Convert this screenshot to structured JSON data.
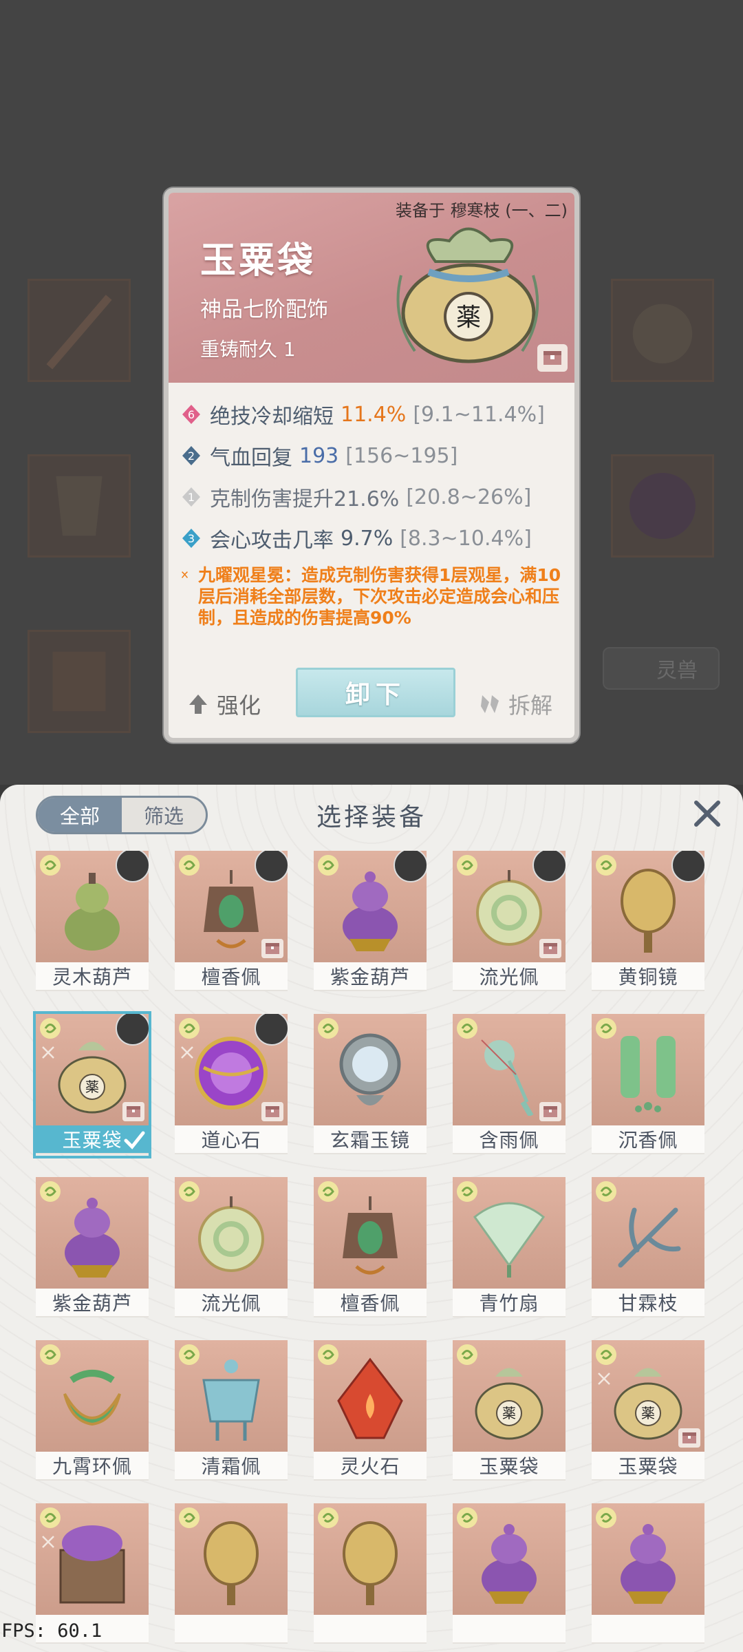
{
  "card": {
    "equipped_on": "装备于 穆寒枝 (一、二)",
    "name": "玉粟袋",
    "grade": "神品七阶配饰",
    "reforge": "重铸耐久 1",
    "stats": [
      {
        "badge": "6",
        "label": "绝技冷却缩短",
        "value": "11.4%",
        "range": "[9.1~11.4%]",
        "badge_color": "#e0608a",
        "value_color": "#e5761c"
      },
      {
        "badge": "2",
        "label": "气血回复",
        "value": "193",
        "range": "[156~195]",
        "badge_color": "#4a6d8c",
        "value_color": "#4a6da8"
      },
      {
        "badge": "1",
        "label": "克制伤害提升21.6%",
        "value": "",
        "range": "[20.8~26%]",
        "badge_color": "#c9c9c9",
        "value_color": "#6c7480"
      },
      {
        "badge": "3",
        "label": "会心攻击几率",
        "value": "9.7%",
        "range": "[8.3~10.4%]",
        "badge_color": "#3aa0c8",
        "value_color": "#4e5d6f"
      }
    ],
    "effect": "九曜观星冕：造成克制伤害获得1层观星，满10层后消耗全部层数，下次攻击必定造成会心和压制，且造成的伤害提高90%",
    "actions": {
      "enhance": "强化",
      "unequip": "卸下",
      "dismantle": "拆解"
    }
  },
  "background": {
    "pill_label": "灵兽"
  },
  "panel": {
    "tabs": [
      "全部",
      "筛选"
    ],
    "title": "选择装备",
    "items": [
      {
        "name": "灵木葫芦",
        "art": "gourd-green",
        "avatar": true,
        "chest": false
      },
      {
        "name": "檀香佩",
        "art": "pendant-jade",
        "avatar": true,
        "chest": true
      },
      {
        "name": "紫金葫芦",
        "art": "gourd-purple",
        "avatar": true,
        "chest": false
      },
      {
        "name": "流光佩",
        "art": "disc-jade",
        "avatar": true,
        "chest": true
      },
      {
        "name": "黄铜镜",
        "art": "mirror-brass",
        "avatar": true,
        "chest": false
      },
      {
        "name": "玉粟袋",
        "art": "bag",
        "avatar": true,
        "chest": true,
        "selected": true,
        "lock": true
      },
      {
        "name": "道心石",
        "art": "orb-purple",
        "avatar": true,
        "chest": true,
        "lock": true
      },
      {
        "name": "玄霜玉镜",
        "art": "mirror-frost",
        "avatar": false,
        "chest": false
      },
      {
        "name": "含雨佩",
        "art": "tassel-jade",
        "avatar": false,
        "chest": true
      },
      {
        "name": "沉香佩",
        "art": "jade-chain",
        "avatar": false,
        "chest": false
      },
      {
        "name": "紫金葫芦",
        "art": "gourd-purple",
        "avatar": false,
        "chest": false
      },
      {
        "name": "流光佩",
        "art": "disc-jade",
        "avatar": false,
        "chest": false
      },
      {
        "name": "檀香佩",
        "art": "pendant-jade",
        "avatar": false,
        "chest": false
      },
      {
        "name": "青竹扇",
        "art": "fan",
        "avatar": false,
        "chest": false
      },
      {
        "name": "甘霖枝",
        "art": "branch",
        "avatar": false,
        "chest": false
      },
      {
        "name": "九霄环佩",
        "art": "ring-jade",
        "avatar": false,
        "chest": false
      },
      {
        "name": "清霜佩",
        "art": "jade-blue",
        "avatar": false,
        "chest": false
      },
      {
        "name": "灵火石",
        "art": "fire-stone",
        "avatar": false,
        "chest": false
      },
      {
        "name": "玉粟袋",
        "art": "bag",
        "avatar": false,
        "chest": false
      },
      {
        "name": "玉粟袋",
        "art": "bag",
        "avatar": false,
        "chest": true,
        "lock": true
      },
      {
        "name": "",
        "art": "box-purple",
        "avatar": false,
        "chest": false,
        "lock": true
      },
      {
        "name": "",
        "art": "mirror-brass",
        "avatar": false,
        "chest": false
      },
      {
        "name": "",
        "art": "mirror-brass",
        "avatar": false,
        "chest": false
      },
      {
        "name": "",
        "art": "gourd-purple",
        "avatar": false,
        "chest": false
      },
      {
        "name": "",
        "art": "gourd-purple",
        "avatar": false,
        "chest": false
      }
    ]
  },
  "fps": "FPS: 60.1",
  "colors": {
    "accent_select": "#57b7cf",
    "effect_orange": "#ef7f1a",
    "tile_bg": "#d9a897"
  }
}
